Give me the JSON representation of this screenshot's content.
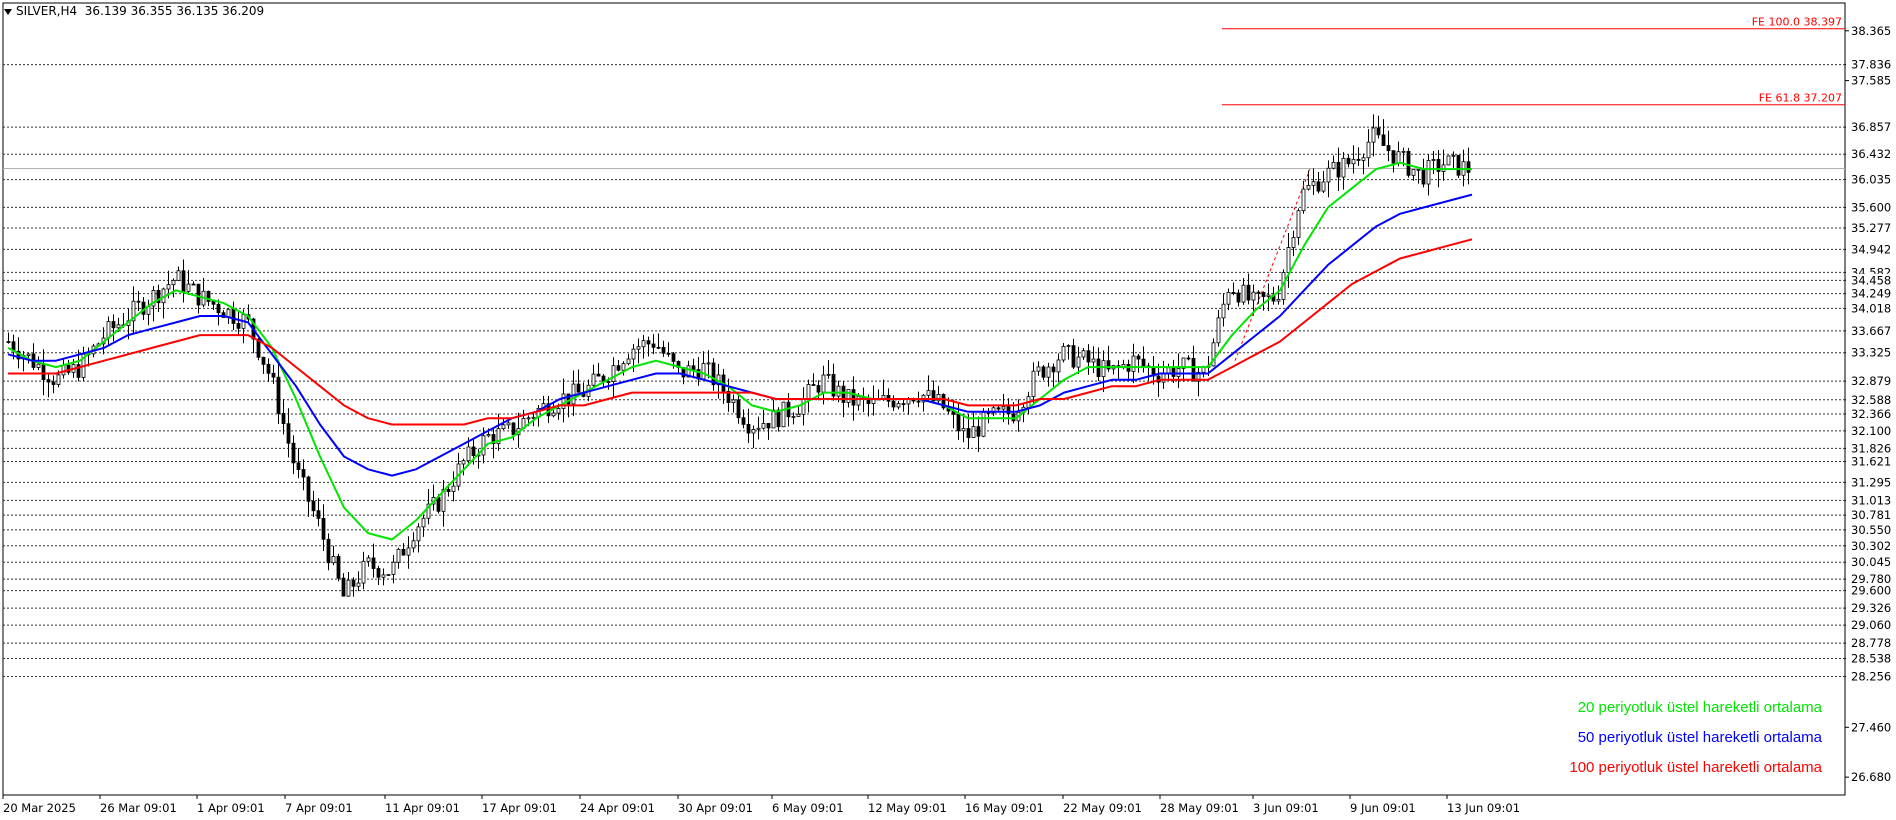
{
  "header": {
    "symbol": "SILVER,H4",
    "ohlc": "36.139 36.355 36.135 36.209"
  },
  "legend": {
    "items": [
      {
        "label": "20 periyotluk üstel hareketli ortalama",
        "color": "#00e600"
      },
      {
        "label": "50 periyotluk üstel hareketli ortalama",
        "color": "#0000ff"
      },
      {
        "label": "100 periyotluk üstel hareketli ortalama",
        "color": "#ff0000"
      }
    ]
  },
  "chart_data": {
    "type": "candlestick",
    "symbol": "SILVER",
    "timeframe": "H4",
    "ylim": [
      26.4,
      38.8
    ],
    "x_tick_labels": [
      "20 Mar 2025",
      "26 Mar 09:01",
      "1 Apr 09:01",
      "7 Apr 09:01",
      "11 Apr 09:01",
      "17 Apr 09:01",
      "24 Apr 09:01",
      "30 Apr 09:01",
      "6 May 09:01",
      "12 May 09:01",
      "16 May 09:01",
      "22 May 09:01",
      "28 May 09:01",
      "3 Jun 09:01",
      "9 Jun 09:01",
      "13 Jun 09:01"
    ],
    "y_tick_labels": [
      38.365,
      37.585,
      27.46,
      26.68
    ],
    "horizontal_levels": [
      37.836,
      36.857,
      36.432,
      36.035,
      35.6,
      35.277,
      34.942,
      34.582,
      34.458,
      34.249,
      34.018,
      33.667,
      33.325,
      32.879,
      32.588,
      32.366,
      32.1,
      31.826,
      31.621,
      31.295,
      31.013,
      30.781,
      30.55,
      30.302,
      30.045,
      29.78,
      29.6,
      29.326,
      29.06,
      28.778,
      28.538,
      28.256
    ],
    "current_price": 36.209,
    "fibonacci_levels": [
      {
        "label": "FE 100.0 38.397",
        "value": 38.397
      },
      {
        "label": "FE 61.8 37.207",
        "value": 37.207
      }
    ],
    "price_path": [
      {
        "label": "20 Mar 2025",
        "value": 33.5
      },
      {
        "value": 33.2
      },
      {
        "value": 32.9
      },
      {
        "value": 33.1
      },
      {
        "value": 33.6
      },
      {
        "label": "26 Mar 09:01",
        "value": 33.9
      },
      {
        "value": 34.2
      },
      {
        "value": 34.5
      },
      {
        "value": 34.2
      },
      {
        "value": 34.0
      },
      {
        "label": "1 Apr 09:01",
        "value": 33.8
      },
      {
        "value": 32.9
      },
      {
        "value": 31.5
      },
      {
        "value": 30.6
      },
      {
        "value": 29.5
      },
      {
        "label": "7 Apr 09:01",
        "value": 30.0
      },
      {
        "value": 29.9
      },
      {
        "value": 30.6
      },
      {
        "value": 31.0
      },
      {
        "value": 31.6
      },
      {
        "label": "11 Apr 09:01",
        "value": 32.0
      },
      {
        "value": 32.1
      },
      {
        "value": 32.4
      },
      {
        "value": 32.6
      },
      {
        "label": "17 Apr 09:01",
        "value": 32.7
      },
      {
        "value": 33.0
      },
      {
        "value": 33.4
      },
      {
        "value": 33.5
      },
      {
        "label": "24 Apr 09:01",
        "value": 33.0
      },
      {
        "value": 33.1
      },
      {
        "value": 32.7
      },
      {
        "value": 32.2
      },
      {
        "label": "30 Apr 09:01",
        "value": 32.3
      },
      {
        "value": 32.5
      },
      {
        "value": 32.9
      },
      {
        "label": "6 May 09:01",
        "value": 32.6
      },
      {
        "value": 32.5
      },
      {
        "value": 32.6
      },
      {
        "label": "12 May 09:01",
        "value": 32.7
      },
      {
        "value": 32.5
      },
      {
        "value": 32.0
      },
      {
        "label": "16 May 09:01",
        "value": 32.3
      },
      {
        "value": 32.4
      },
      {
        "value": 33.0
      },
      {
        "value": 33.3
      },
      {
        "label": "22 May 09:01",
        "value": 33.2
      },
      {
        "value": 33.0
      },
      {
        "value": 33.2
      },
      {
        "value": 33.0
      },
      {
        "label": "28 May 09:01",
        "value": 33.1
      },
      {
        "value": 33.0
      },
      {
        "value": 34.4
      },
      {
        "value": 34.1
      },
      {
        "label": "3 Jun 09:01",
        "value": 34.2
      },
      {
        "value": 35.8
      },
      {
        "value": 36.1
      },
      {
        "value": 36.3
      },
      {
        "label": "9 Jun 09:01",
        "value": 36.7
      },
      {
        "value": 36.4
      },
      {
        "value": 36.1
      },
      {
        "value": 36.3
      },
      {
        "label": "13 Jun 09:01",
        "value": 36.2
      }
    ],
    "series": [
      {
        "name": "20 periyotluk üstel hareketli ortalama",
        "color": "#00e600",
        "values": [
          33.4,
          33.2,
          33.1,
          33.2,
          33.5,
          33.8,
          34.1,
          34.3,
          34.2,
          34.1,
          33.9,
          33.4,
          32.6,
          31.7,
          30.9,
          30.5,
          30.4,
          30.7,
          31.1,
          31.5,
          31.9,
          32.0,
          32.3,
          32.5,
          32.7,
          32.9,
          33.1,
          33.2,
          33.1,
          33.0,
          32.8,
          32.5,
          32.4,
          32.5,
          32.7,
          32.7,
          32.6,
          32.6,
          32.6,
          32.5,
          32.3,
          32.3,
          32.3,
          32.6,
          32.9,
          33.1,
          33.1,
          33.1,
          33.1,
          33.1,
          33.1,
          33.6,
          34.0,
          34.3,
          35.0,
          35.6,
          35.9,
          36.2,
          36.3,
          36.2,
          36.2,
          36.2
        ]
      },
      {
        "name": "50 periyotluk üstel hareketli ortalama",
        "color": "#0000ff",
        "values": [
          33.3,
          33.2,
          33.2,
          33.3,
          33.4,
          33.6,
          33.7,
          33.8,
          33.9,
          33.9,
          33.8,
          33.3,
          32.8,
          32.2,
          31.7,
          31.5,
          31.4,
          31.5,
          31.7,
          31.9,
          32.1,
          32.3,
          32.4,
          32.6,
          32.7,
          32.8,
          32.9,
          33.0,
          33.0,
          32.9,
          32.8,
          32.7,
          32.6,
          32.6,
          32.6,
          32.6,
          32.6,
          32.6,
          32.6,
          32.5,
          32.4,
          32.4,
          32.4,
          32.5,
          32.7,
          32.8,
          32.9,
          32.9,
          33.0,
          33.0,
          33.0,
          33.3,
          33.6,
          33.9,
          34.3,
          34.7,
          35.0,
          35.3,
          35.5,
          35.6,
          35.7,
          35.8
        ]
      },
      {
        "name": "100 periyotluk üstel hareketli ortalama",
        "color": "#ff0000",
        "values": [
          33.0,
          33.0,
          33.0,
          33.1,
          33.2,
          33.3,
          33.4,
          33.5,
          33.6,
          33.6,
          33.6,
          33.4,
          33.1,
          32.8,
          32.5,
          32.3,
          32.2,
          32.2,
          32.2,
          32.2,
          32.3,
          32.3,
          32.4,
          32.5,
          32.5,
          32.6,
          32.7,
          32.7,
          32.7,
          32.7,
          32.7,
          32.7,
          32.6,
          32.6,
          32.6,
          32.6,
          32.6,
          32.6,
          32.6,
          32.6,
          32.5,
          32.5,
          32.5,
          32.6,
          32.6,
          32.7,
          32.8,
          32.8,
          32.9,
          32.9,
          32.9,
          33.1,
          33.3,
          33.5,
          33.8,
          34.1,
          34.4,
          34.6,
          34.8,
          34.9,
          35.0,
          35.1
        ]
      }
    ]
  }
}
